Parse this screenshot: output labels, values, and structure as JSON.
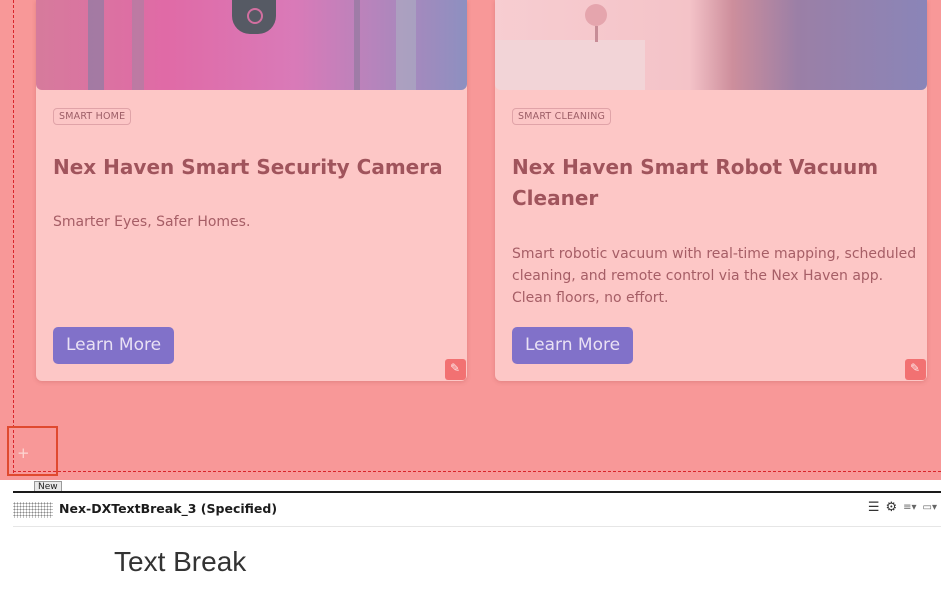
{
  "cards": [
    {
      "tag": "SMART HOME",
      "title": "Nex Haven Smart Security Camera",
      "description": "Smarter Eyes, Safer Homes.",
      "button": "Learn More",
      "edit_icon": "✎"
    },
    {
      "tag": "SMART CLEANING",
      "title_line1": "Nex Haven Smart Robot Vacuum",
      "title_line2": "Cleaner",
      "description_line1": "Smart robotic vacuum with real-time mapping, scheduled",
      "description_line2": "cleaning, and remote control via the Nex Haven app.",
      "description_line3": "Clean floors, no effort.",
      "button": "Learn More",
      "edit_icon": "✎"
    }
  ],
  "add_button": {
    "icon": "+",
    "tooltip": "New"
  },
  "panel": {
    "title": "Nex-DXTextBreak_3 (Specified)",
    "tool_icons": [
      "☰",
      "⚙",
      "≡▾",
      "▭▾"
    ],
    "content_text": "Text Break"
  },
  "colors": {
    "canvas": "#f89898",
    "card": "#fdc7c6",
    "button": "#8171c9",
    "dashed_outline": "#d9262b"
  }
}
